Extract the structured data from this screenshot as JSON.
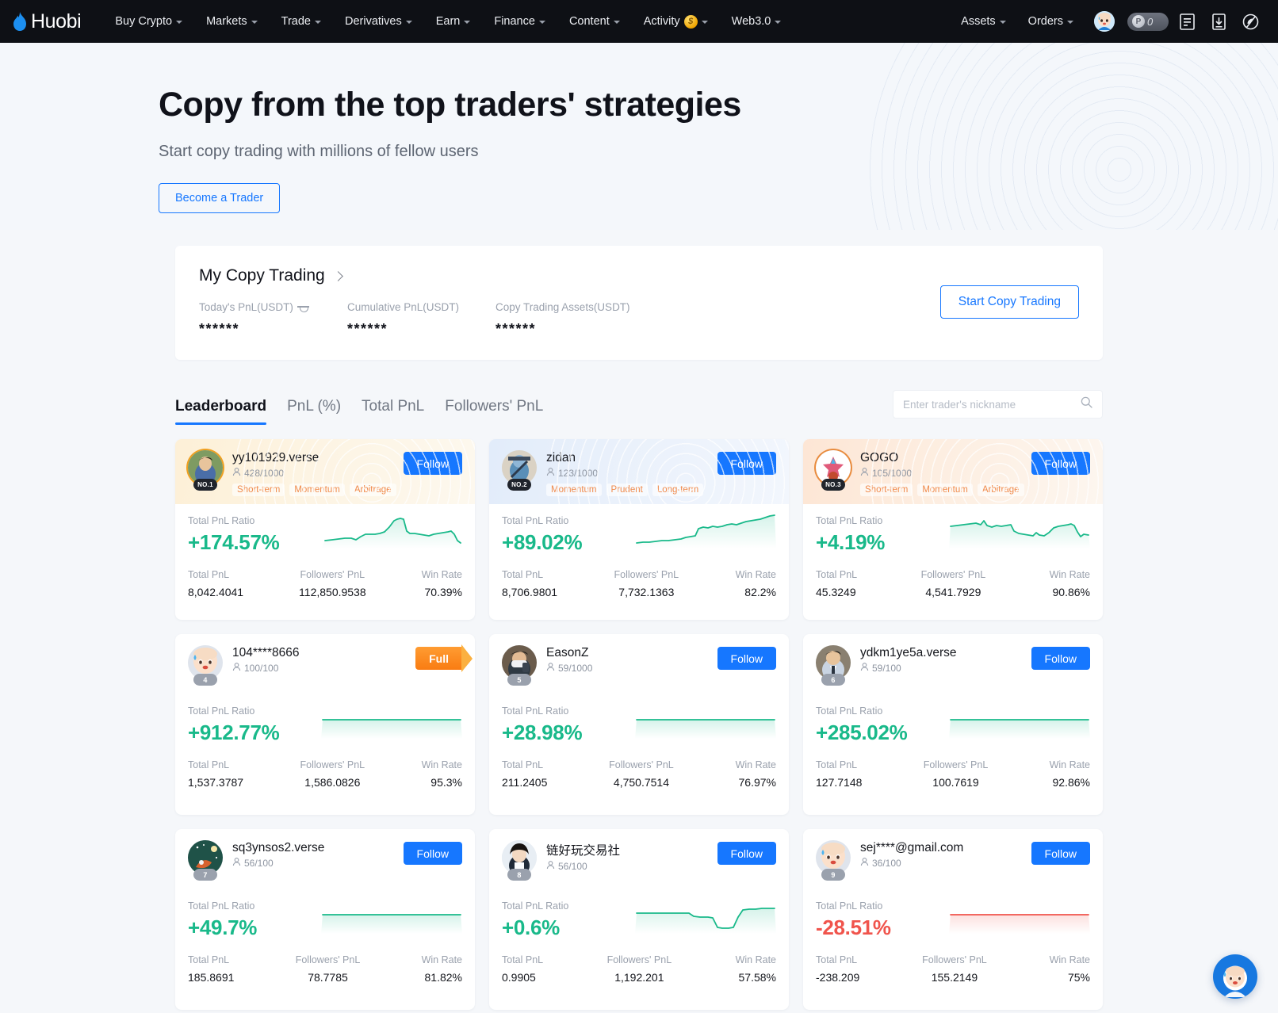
{
  "navbar": {
    "brand": "Huobi",
    "left_links": [
      {
        "label": "Buy Crypto",
        "caret": true
      },
      {
        "label": "Markets",
        "caret": true
      },
      {
        "label": "Trade",
        "caret": true
      },
      {
        "label": "Derivatives",
        "caret": true
      },
      {
        "label": "Earn",
        "caret": true
      },
      {
        "label": "Finance",
        "caret": true
      },
      {
        "label": "Content",
        "caret": true
      },
      {
        "label": "Activity",
        "caret": true,
        "coin": "$"
      },
      {
        "label": "Web3.0",
        "caret": true
      }
    ],
    "right_links": [
      {
        "label": "Assets",
        "caret": true
      },
      {
        "label": "Orders",
        "caret": true
      }
    ],
    "points_value": "0",
    "points_coin": "P",
    "icons": [
      "user-avatar-icon",
      "points-pill-icon",
      "order-list-icon",
      "download-icon",
      "night-mode-icon"
    ]
  },
  "hero": {
    "title": "Copy from the top traders' strategies",
    "subtitle": "Start copy trading with millions of fellow users",
    "cta": "Become a Trader"
  },
  "my_copy_trading": {
    "title": "My Copy Trading",
    "stats": [
      {
        "label": "Today's PnL(USDT)",
        "value": "******",
        "has_eye": true
      },
      {
        "label": "Cumulative PnL(USDT)",
        "value": "******",
        "has_eye": false
      },
      {
        "label": "Copy Trading Assets(USDT)",
        "value": "******",
        "has_eye": false
      }
    ],
    "cta": "Start Copy Trading"
  },
  "tabs": [
    {
      "label": "Leaderboard",
      "active": true
    },
    {
      "label": "PnL (%)",
      "active": false
    },
    {
      "label": "Total PnL",
      "active": false
    },
    {
      "label": "Followers' PnL",
      "active": false
    }
  ],
  "search": {
    "placeholder": "Enter trader's nickname",
    "value": "",
    "icon": "search-icon"
  },
  "card_labels": {
    "ratio": "Total PnL Ratio",
    "total_pnl": "Total PnL",
    "followers_pnl": "Followers' PnL",
    "win_rate": "Win Rate",
    "follow": "Follow",
    "full": "Full"
  },
  "traders": [
    {
      "name": "yy101929.verse",
      "followers": "428/1000",
      "rank": "NO.1",
      "rank_style": "top",
      "head_style": "gold",
      "avatar_ring": "ring-gold",
      "tags": [
        "Short-term",
        "Momentum",
        "Arbitrage"
      ],
      "ratio": "+174.57%",
      "direction": "up",
      "total_pnl": "8,042.4041",
      "followers_pnl": "112,850.9538",
      "win_rate": "70.39%",
      "action": "follow",
      "spark": "5,38 14,37 22,36 30,35 38,35 44,37 50,33 56,30 62,30 68,30 74,29 80,27 86,21 92,13 96,11 100,10 104,11 108,26 112,29 118,29 124,30 130,31 136,32 142,30 148,29 154,28 160,27 164,26 168,30 172,38 176,41"
    },
    {
      "name": "zidan",
      "followers": "123/1000",
      "rank": "NO.2",
      "rank_style": "top",
      "head_style": "silver",
      "avatar_ring": "",
      "tags": [
        "Momentum",
        "Prudent",
        "Long-term"
      ],
      "ratio": "+89.02%",
      "direction": "up",
      "total_pnl": "8,706.9801",
      "followers_pnl": "7,732.1363",
      "win_rate": "82.2%",
      "action": "follow",
      "spark": "2,41 10,40 18,40 26,39 34,38 42,38 50,37 58,36 64,34 70,33 76,32 80,23 86,21 92,22 98,20 104,21 110,20 116,18 122,17 128,18 134,16 140,14 146,13 152,12 158,11 164,9 170,7 176,6"
    },
    {
      "name": "GOGO",
      "followers": "105/1000",
      "rank": "NO.3",
      "rank_style": "top",
      "head_style": "bronze",
      "avatar_ring": "ring-bronze",
      "tags": [
        "Short-term",
        "Momentum",
        "Arbitrage"
      ],
      "ratio": "+4.19%",
      "direction": "up",
      "total_pnl": "45.3249",
      "followers_pnl": "4,541.7929",
      "win_rate": "90.86%",
      "action": "follow",
      "spark": "2,20 10,19 18,18 26,17 34,16 40,18 44,13 48,19 54,21 60,19 66,20 72,19 78,18 82,26 88,29 94,30 100,31 106,32 110,28 114,31 120,32 126,28 132,22 138,20 144,19 150,18 154,17 158,19 162,27 166,33 170,30 176,31"
    },
    {
      "name": "104****8666",
      "followers": "100/100",
      "rank": "4",
      "rank_style": "plain",
      "head_style": "plain",
      "avatar_ring": "",
      "tags": [],
      "ratio": "+912.77%",
      "direction": "up",
      "total_pnl": "1,537.3787",
      "followers_pnl": "1,586.0826",
      "win_rate": "95.3%",
      "action": "full",
      "spark": "2,24 40,24 80,24 120,24 176,24"
    },
    {
      "name": "EasonZ",
      "followers": "59/1000",
      "rank": "5",
      "rank_style": "plain",
      "head_style": "plain",
      "avatar_ring": "",
      "tags": [],
      "ratio": "+28.98%",
      "direction": "up",
      "total_pnl": "211.2405",
      "followers_pnl": "4,750.7514",
      "win_rate": "76.97%",
      "action": "follow",
      "spark": "2,24 40,24 80,24 120,24 176,24"
    },
    {
      "name": "ydkm1ye5a.verse",
      "followers": "59/100",
      "rank": "6",
      "rank_style": "plain",
      "head_style": "plain",
      "avatar_ring": "",
      "tags": [],
      "ratio": "+285.02%",
      "direction": "up",
      "total_pnl": "127.7148",
      "followers_pnl": "100.7619",
      "win_rate": "92.86%",
      "action": "follow",
      "spark": "2,24 40,24 80,24 120,24 176,24"
    },
    {
      "name": "sq3ynsos2.verse",
      "followers": "56/100",
      "rank": "7",
      "rank_style": "plain",
      "head_style": "plain",
      "avatar_ring": "",
      "tags": [],
      "ratio": "+49.7%",
      "direction": "up",
      "total_pnl": "185.8691",
      "followers_pnl": "78.7785",
      "win_rate": "81.82%",
      "action": "follow",
      "spark": "2,24 40,24 80,24 120,24 176,24"
    },
    {
      "name": "链好玩交易社",
      "followers": "56/100",
      "rank": "8",
      "rank_style": "plain",
      "head_style": "plain",
      "avatar_ring": "",
      "tags": [],
      "ratio": "+0.6%",
      "direction": "up",
      "total_pnl": "0.9905",
      "followers_pnl": "1,192.201",
      "win_rate": "57.58%",
      "action": "follow",
      "spark": "2,22 30,22 60,22 68,22 74,26 82,27 92,27 98,28 104,40 110,41 118,41 124,40 130,27 136,18 144,17 152,17 160,16 168,16 176,16"
    },
    {
      "name": "sej****@gmail.com",
      "followers": "36/100",
      "rank": "9",
      "rank_style": "plain",
      "head_style": "plain",
      "avatar_ring": "",
      "tags": [],
      "ratio": "-28.51%",
      "direction": "down",
      "total_pnl": "-238.209",
      "followers_pnl": "155.2149",
      "win_rate": "75%",
      "action": "follow",
      "spark": "2,24 40,24 80,24 120,24 176,24"
    }
  ],
  "chat": {
    "icon": "customer-service-avatar-icon"
  },
  "colors": {
    "accent": "#1677ff",
    "up": "#19b98a",
    "down": "#f0544c",
    "nav_bg": "#0e1015",
    "page_bg": "#f5f7fa",
    "full_badge": "#f97c12"
  }
}
